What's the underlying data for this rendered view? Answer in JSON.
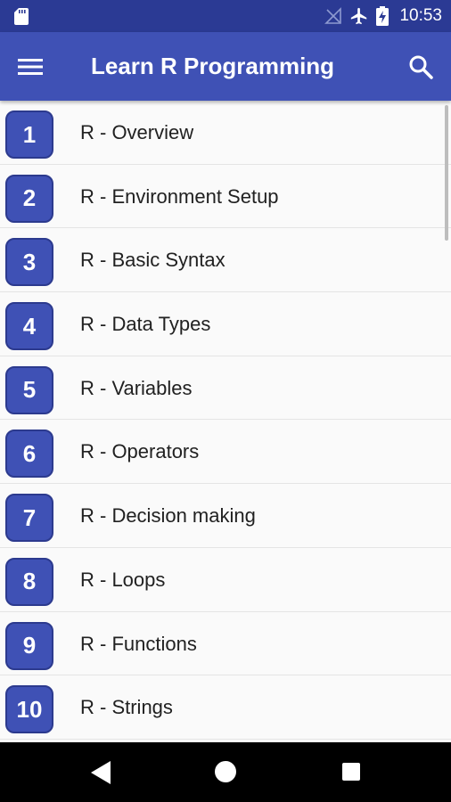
{
  "status_bar": {
    "time": "10:53"
  },
  "app_bar": {
    "title": "Learn R Programming"
  },
  "topics": [
    {
      "number": "1",
      "label": "R - Overview"
    },
    {
      "number": "2",
      "label": "R - Environment Setup"
    },
    {
      "number": "3",
      "label": "R - Basic Syntax"
    },
    {
      "number": "4",
      "label": "R - Data Types"
    },
    {
      "number": "5",
      "label": "R - Variables"
    },
    {
      "number": "6",
      "label": "R - Operators"
    },
    {
      "number": "7",
      "label": "R - Decision making"
    },
    {
      "number": "8",
      "label": "R - Loops"
    },
    {
      "number": "9",
      "label": "R - Functions"
    },
    {
      "number": "10",
      "label": "R - Strings"
    }
  ],
  "colors": {
    "primary": "#3f51b5",
    "primary_dark": "#2b3a94",
    "text": "#212121"
  }
}
